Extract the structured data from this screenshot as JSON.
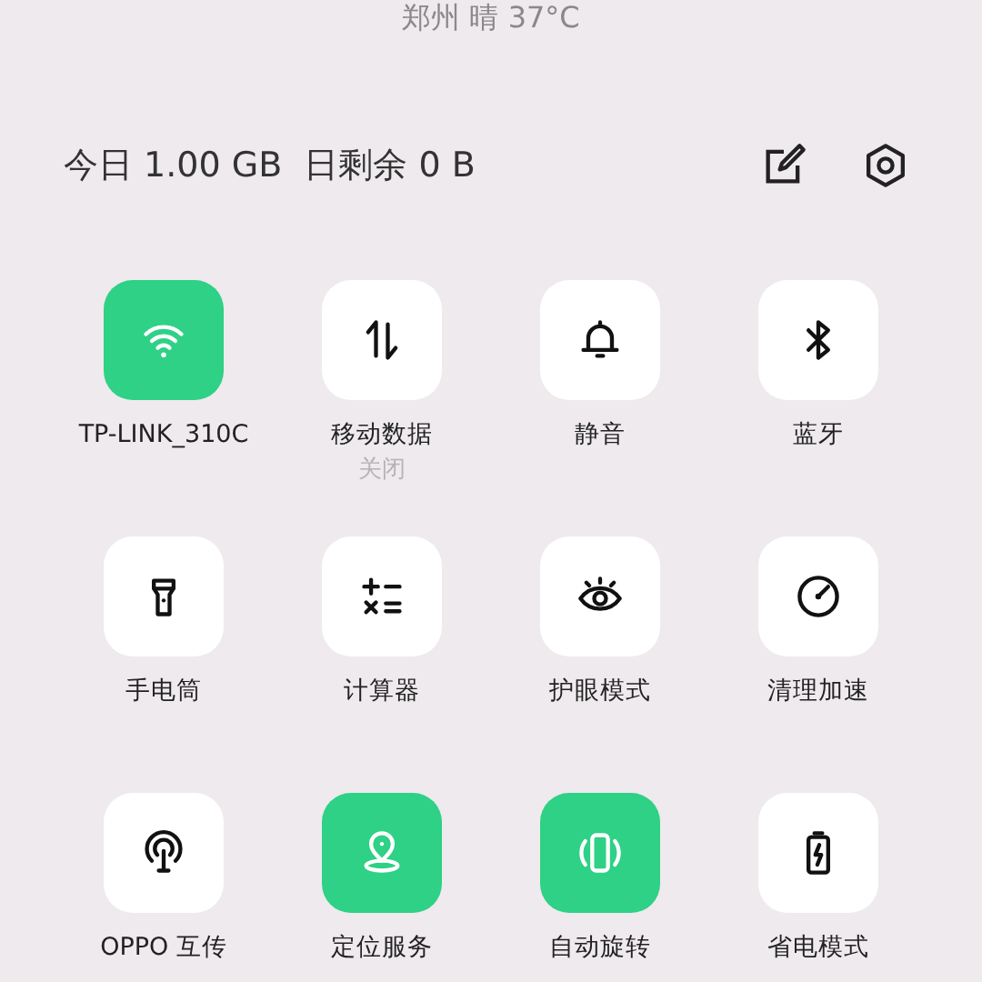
{
  "weather": "郑州 晴 37°C",
  "usage": "今日 1.00 GB  日剩余 0 B",
  "tiles": [
    {
      "label": "TP-LINK_310C",
      "on": true
    },
    {
      "label": "移动数据",
      "status": "关闭",
      "on": false
    },
    {
      "label": "静音",
      "on": false
    },
    {
      "label": "蓝牙",
      "on": false
    },
    {
      "label": "手电筒",
      "on": false
    },
    {
      "label": "计算器",
      "on": false
    },
    {
      "label": "护眼模式",
      "on": false
    },
    {
      "label": "清理加速",
      "on": false
    },
    {
      "label": "OPPO 互传",
      "on": false
    },
    {
      "label": "定位服务",
      "on": true
    },
    {
      "label": "自动旋转",
      "on": true
    },
    {
      "label": "省电模式",
      "on": false
    }
  ]
}
